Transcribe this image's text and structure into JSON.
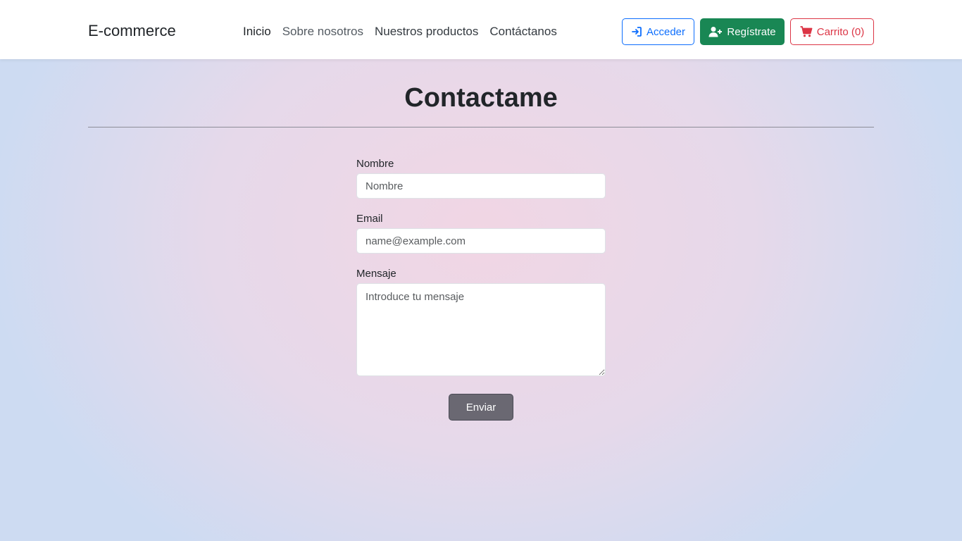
{
  "navbar": {
    "brand": "E-commerce",
    "links": [
      {
        "label": "Inicio"
      },
      {
        "label": "Sobre nosotros"
      },
      {
        "label": "Nuestros productos"
      },
      {
        "label": "Contáctanos"
      }
    ],
    "login_label": "Acceder",
    "login_icon": "sign-in-icon",
    "register_label": "Regístrate",
    "register_icon": "user-plus-icon",
    "cart_label": "Carrito (0)",
    "cart_icon": "cart-icon"
  },
  "colors": {
    "primary": "#0d6efd",
    "success": "#198754",
    "danger": "#dc3545",
    "submit": "#6a6872"
  },
  "contact": {
    "title": "Contactame",
    "name_label": "Nombre",
    "name_placeholder": "Nombre",
    "email_label": "Email",
    "email_placeholder": "name@example.com",
    "message_label": "Mensaje",
    "message_placeholder": "Introduce tu mensaje",
    "submit_label": "Enviar"
  }
}
